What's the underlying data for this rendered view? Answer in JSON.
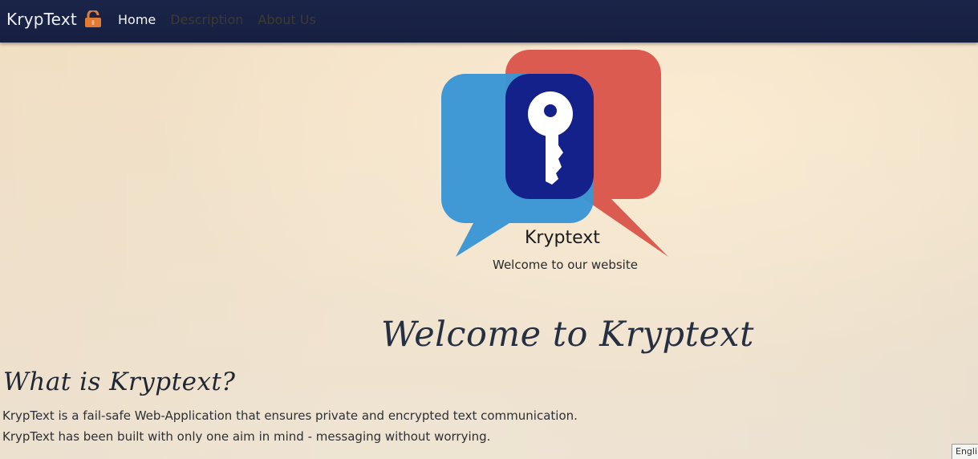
{
  "navbar": {
    "brand": "KrypText",
    "brand_icon": "lock-icon",
    "links": [
      {
        "label": "Home",
        "active": true
      },
      {
        "label": "Description",
        "active": false
      },
      {
        "label": "About Us",
        "active": false
      }
    ]
  },
  "hero": {
    "logo_icon": "key-chat-bubbles-icon",
    "logo_title": "Kryptext",
    "subtitle": "Welcome to our website"
  },
  "welcome": {
    "heading": "Welcome to Kryptext"
  },
  "about": {
    "heading": "What is Kryptext?",
    "lines": [
      "KrypText is a fail-safe Web-Application that ensures private and encrypted text communication.",
      "KrypText has been built with only one aim in mind - messaging without worrying."
    ]
  },
  "language_selector": {
    "label": "Engli"
  },
  "colors": {
    "navbar": "#1a2448",
    "bubble_blue": "#3a96d4",
    "bubble_red": "#d9534a",
    "bubble_overlap": "#14218a",
    "text_heading": "#263042"
  }
}
